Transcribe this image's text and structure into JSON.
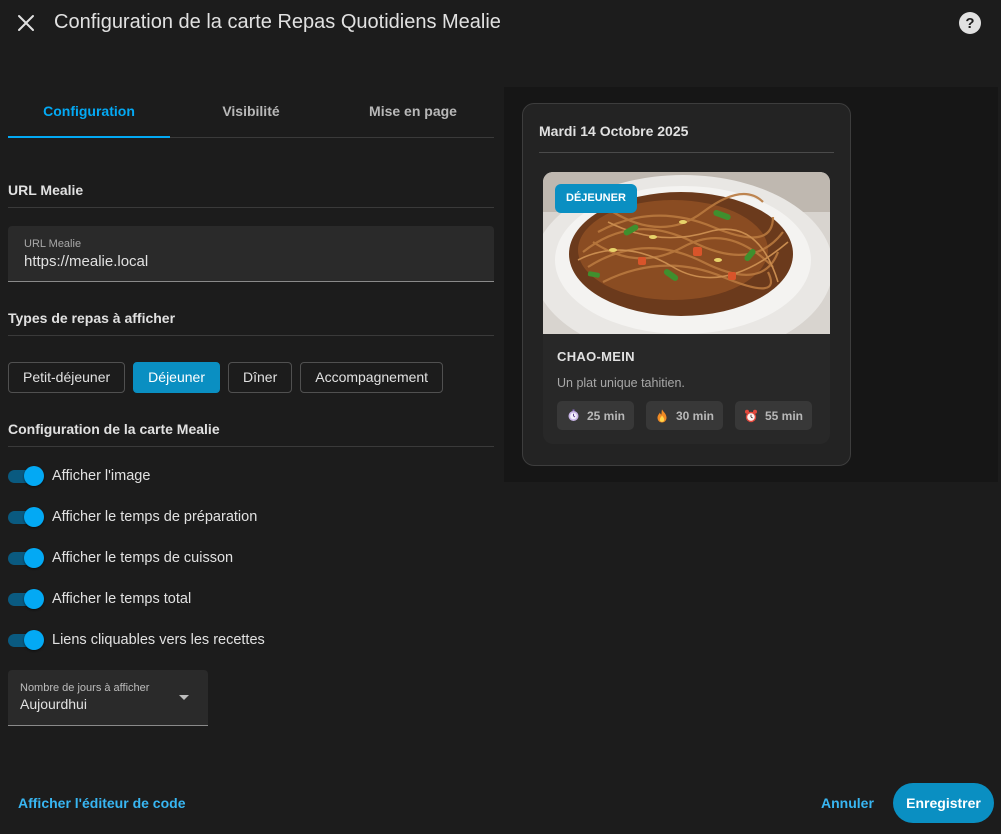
{
  "dialog": {
    "title": "Configuration de la carte Repas Quotidiens Mealie"
  },
  "tabs": [
    {
      "label": "Configuration",
      "active": true
    },
    {
      "label": "Visibilité",
      "active": false
    },
    {
      "label": "Mise en page",
      "active": false
    }
  ],
  "url_section": {
    "title": "URL Mealie",
    "field_label": "URL Mealie",
    "field_value": "https://mealie.local"
  },
  "meal_types": {
    "title": "Types de repas à afficher",
    "options": [
      {
        "label": "Petit-déjeuner",
        "selected": false
      },
      {
        "label": "Déjeuner",
        "selected": true
      },
      {
        "label": "Dîner",
        "selected": false
      },
      {
        "label": "Accompagnement",
        "selected": false
      }
    ]
  },
  "card_config": {
    "title": "Configuration de la carte Mealie",
    "toggles": [
      {
        "label": "Afficher l'image",
        "checked": true
      },
      {
        "label": "Afficher le temps de préparation",
        "checked": true
      },
      {
        "label": "Afficher le temps de cuisson",
        "checked": true
      },
      {
        "label": "Afficher le temps total",
        "checked": true
      },
      {
        "label": "Liens cliquables vers les recettes",
        "checked": true
      }
    ],
    "days_select": {
      "label": "Nombre de jours à afficher",
      "value": "Aujourdhui"
    }
  },
  "footer": {
    "code_editor_label": "Afficher l'éditeur de code",
    "cancel_label": "Annuler",
    "save_label": "Enregistrer"
  },
  "preview": {
    "date": "Mardi 14 Octobre 2025",
    "meal_badge": "DÉJEUNER",
    "recipe_name": "CHAO-MEIN",
    "recipe_description": "Un plat unique tahitien.",
    "times": [
      {
        "icon": "prep-timer-icon",
        "value": "25 min"
      },
      {
        "icon": "fire-icon",
        "value": "30 min"
      },
      {
        "icon": "alarm-clock-icon",
        "value": "55 min"
      }
    ]
  },
  "colors": {
    "accent": "#03a9f4",
    "button_active": "#0a8fc2",
    "background": "#1c1c1c",
    "card": "#232323"
  }
}
